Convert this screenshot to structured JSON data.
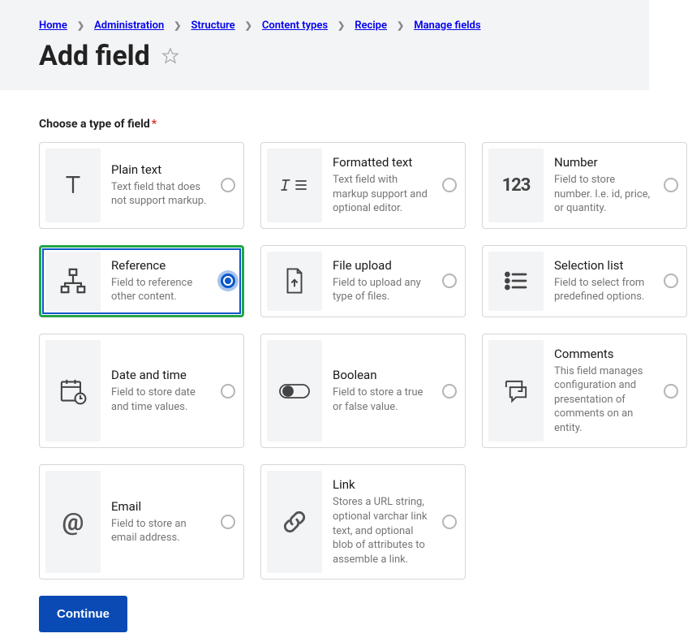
{
  "breadcrumb": [
    "Home",
    "Administration",
    "Structure",
    "Content types",
    "Recipe",
    "Manage fields"
  ],
  "page_title": "Add field",
  "section_label": "Choose a type of field",
  "required_marker": "*",
  "continue_label": "Continue",
  "fields": [
    {
      "id": "plain-text",
      "title": "Plain text",
      "desc": "Text field that does not support markup.",
      "icon": "text",
      "selected": false
    },
    {
      "id": "formatted-text",
      "title": "Formatted text",
      "desc": "Text field with markup support and optional editor.",
      "icon": "formatted",
      "selected": false
    },
    {
      "id": "number",
      "title": "Number",
      "desc": "Field to store number. I.e. id, price, or quantity.",
      "icon": "number",
      "selected": false
    },
    {
      "id": "reference",
      "title": "Reference",
      "desc": "Field to reference other content.",
      "icon": "reference",
      "selected": true
    },
    {
      "id": "file-upload",
      "title": "File upload",
      "desc": "Field to upload any type of files.",
      "icon": "file",
      "selected": false
    },
    {
      "id": "selection-list",
      "title": "Selection list",
      "desc": "Field to select from predefined options.",
      "icon": "list",
      "selected": false
    },
    {
      "id": "date-time",
      "title": "Date and time",
      "desc": "Field to store date and time values.",
      "icon": "datetime",
      "selected": false
    },
    {
      "id": "boolean",
      "title": "Boolean",
      "desc": "Field to store a true or false value.",
      "icon": "boolean",
      "selected": false
    },
    {
      "id": "comments",
      "title": "Comments",
      "desc": "This field manages configuration and presentation of comments on an entity.",
      "icon": "comments",
      "selected": false
    },
    {
      "id": "email",
      "title": "Email",
      "desc": "Field to store an email address.",
      "icon": "email",
      "selected": false
    },
    {
      "id": "link",
      "title": "Link",
      "desc": "Stores a URL string, optional varchar link text, and optional blob of attributes to assemble a link.",
      "icon": "link",
      "selected": false
    }
  ]
}
